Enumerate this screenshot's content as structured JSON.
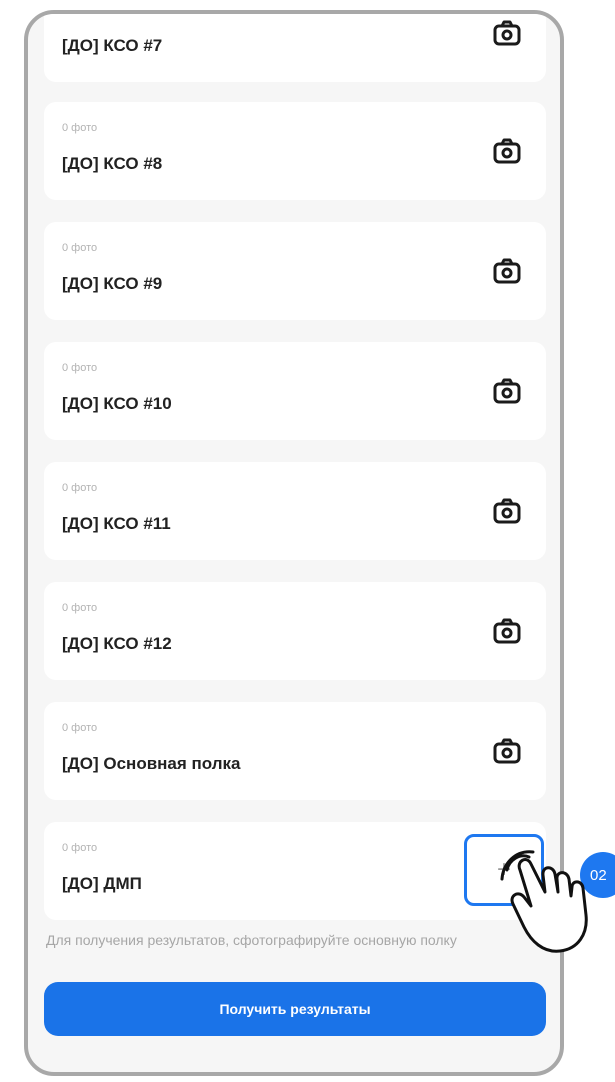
{
  "cards": [
    {
      "meta": "",
      "title": "[ДО] КСО #7",
      "action": "camera-icon"
    },
    {
      "meta": "0 фото",
      "title": "[ДО] КСО #8",
      "action": "camera-icon"
    },
    {
      "meta": "0 фото",
      "title": "[ДО] КСО #9",
      "action": "camera-icon"
    },
    {
      "meta": "0 фото",
      "title": "[ДО] КСО #10",
      "action": "camera-icon"
    },
    {
      "meta": "0 фото",
      "title": "[ДО] КСО #11",
      "action": "camera-icon"
    },
    {
      "meta": "0 фото",
      "title": "[ДО] КСО #12",
      "action": "camera-icon"
    },
    {
      "meta": "0 фото",
      "title": "[ДО] Основная полка",
      "action": "camera-icon"
    },
    {
      "meta": "0 фото",
      "title": "[ДО] ДМП",
      "action": "plus-icon"
    }
  ],
  "add_symbol": "+",
  "hint": "Для получения результатов, сфотографируйте основную полку",
  "button_label": "Получить результаты",
  "step_badge": "02",
  "colors": {
    "accent": "#1a73e8",
    "card_background": "#ffffff",
    "screen_background": "#f6f6f6",
    "muted_text": "#a6a6a6"
  }
}
